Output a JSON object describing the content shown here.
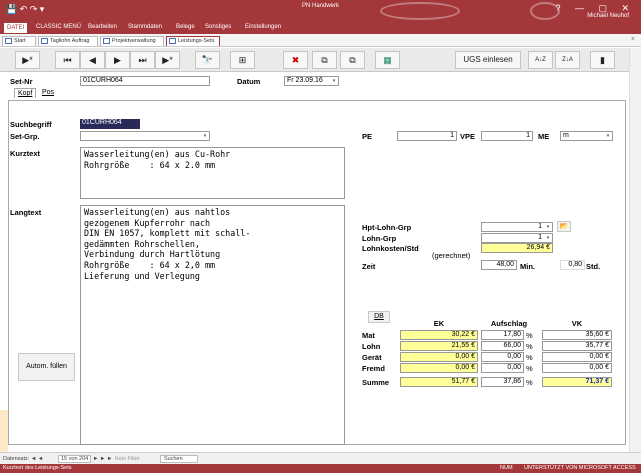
{
  "titlebar": {
    "qat": "💾 ↶ ↷ ▾",
    "title": "PN Handwerk",
    "window_controls": "? — ▢ ✕",
    "user": "Michael Neuhof"
  },
  "ribbon": {
    "items": [
      "DATEI",
      "CLASSIC MENÜ",
      "Bearbeiten",
      "Stammdaten",
      "Belege",
      "Sonstiges",
      "Einstellungen"
    ]
  },
  "doc_tabs": [
    "Start",
    "Tagliohn Auftrag",
    "Projektverwaltung",
    "Leistungs-Sets"
  ],
  "toolbar": {
    "first": "⏮",
    "prev": "◀",
    "next": "▶",
    "last": "⏭",
    "new": "▶*",
    "find": "🔭",
    "excel": "⊞",
    "delete": "✖",
    "copy": "⧉",
    "paste": "⧉",
    "green": "▦",
    "ugs": "UGS einlesen",
    "sort_asc": "A↓Z",
    "sort_desc": "Z↓A",
    "close": "▮"
  },
  "header": {
    "set_nr_label": "Set-Nr",
    "set_nr_value": "01CURH064",
    "datum_label": "Datum",
    "datum_value": "Fr 23.09.16",
    "datum_dd": "▾"
  },
  "subtabs": [
    "Kopf",
    "Pos"
  ],
  "fields": {
    "suchbegriff_label": "Suchbegriff",
    "suchbegriff_value": "01CURH064",
    "setgrp_label": "Set-Grp.",
    "setgrp_value": "",
    "kurztext_label": "Kurztext",
    "kurztext_value": "Wasserleitung(en) aus Cu-Rohr\nRohrgröße    : 64 x 2.0 mm",
    "langtext_label": "Langtext",
    "langtext_value": "Wasserleitung(en) aus nahtlos\ngezogenem Kupferrohr nach\nDIN EN 1057, komplett mit schall-\ngedämmten Rohrschellen,\nVerbindung durch Hartlötung\nRohrgröße    : 64 x 2,0 mm\nLieferung und Verlegung",
    "pe_label": "PE",
    "pe_value": "1",
    "vpe_label": "VPE",
    "vpe_value": "1",
    "me_label": "ME",
    "me_value": "m",
    "hptlohngrp_label": "Hpt-Lohn-Grp",
    "hptlohngrp_value": "1",
    "lohngrp_label": "Lohn-Grp",
    "lohngrp_value": "1",
    "lohnkosten_label": "Lohnkosten/Std",
    "lohnkosten_note": "(gerechnet)",
    "lohnkosten_value": "26,94 €",
    "zeit_label": "Zeit",
    "zeit_min_value": "48,00",
    "zeit_min_unit": "Min.",
    "zeit_std_value": "0,80",
    "zeit_std_unit": "Std."
  },
  "buttons": {
    "autom": "Autom. füllen",
    "db": "DB",
    "folder": "📂"
  },
  "table": {
    "headers": [
      "EK",
      "Aufschlag",
      "VK"
    ],
    "rows": [
      {
        "label": "Mat",
        "ek": "30,22 €",
        "auf": "17,80",
        "pct": "%",
        "vk": "35,60 €"
      },
      {
        "label": "Lohn",
        "ek": "21,55 €",
        "auf": "66,00",
        "pct": "%",
        "vk": "35,77 €"
      },
      {
        "label": "Gerät",
        "ek": "0,00 €",
        "auf": "0,00",
        "pct": "%",
        "vk": "0,00 €"
      },
      {
        "label": "Fremd",
        "ek": "0,00 €",
        "auf": "0,00",
        "pct": "%",
        "vk": "0,00 €"
      },
      {
        "label": "Summe",
        "ek": "51,77 €",
        "auf": "37,86",
        "pct": "%",
        "vk": "71,37 €"
      }
    ]
  },
  "statusbar": {
    "record_prefix": "Datensatz: ◄ ◄",
    "record": "15 von 204",
    "nav": "► ► ►",
    "filter": "Kein Filter",
    "search": "Suchen"
  },
  "bottombar": {
    "left": "Kurztext des Leistungs-Sets",
    "num": "NUM",
    "right": "UNTERSTÜTZT VON MICROSOFT ACCESS"
  }
}
